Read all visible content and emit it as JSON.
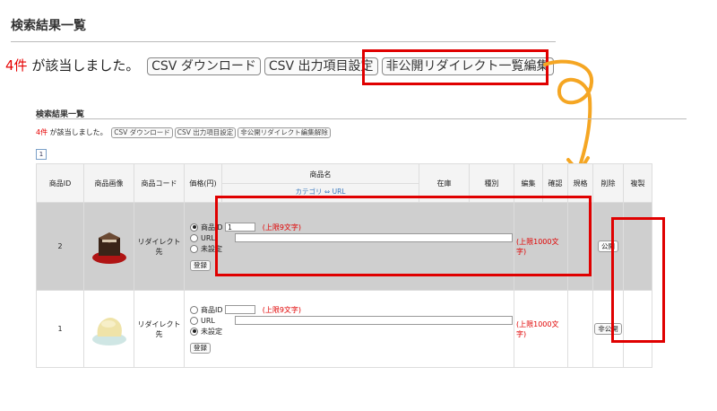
{
  "big": {
    "title": "検索結果一覧",
    "count": "4件",
    "summary": "が該当しました。",
    "btn_csv_download": "CSV ダウンロード",
    "btn_csv_settings": "CSV 出力項目設定",
    "btn_redirect_edit": "非公開リダイレクト一覧編集"
  },
  "small": {
    "title": "検索結果一覧",
    "count": "4件",
    "summary": "が該当しました。",
    "btn_csv_download": "CSV ダウンロード",
    "btn_csv_settings": "CSV 出力項目設定",
    "btn_redirect_cancel": "非公開リダイレクト編集解除",
    "page": "1"
  },
  "table": {
    "headers": {
      "id": "商品ID",
      "image": "商品画像",
      "code": "商品コード",
      "price": "価格(円)",
      "name": "商品名",
      "name_sub": "カテゴリ ⇔ URL",
      "stock": "在庫",
      "type": "種別",
      "edit": "編集",
      "confirm": "確認",
      "spec": "規格",
      "delete": "削除",
      "copy": "複製"
    },
    "rows": [
      {
        "id": "2",
        "code": "リダイレクト先",
        "opt_id": "商品ID",
        "id_value": "1",
        "id_limit": "(上限9文字)",
        "opt_url": "URL",
        "url_value": "",
        "url_limit": "(上限1000文字)",
        "opt_none": "未設定",
        "register": "登録",
        "status_btn": "公開"
      },
      {
        "id": "1",
        "code": "リダイレクト先",
        "opt_id": "商品ID",
        "id_value": "",
        "id_limit": "(上限9文字)",
        "opt_url": "URL",
        "url_value": "",
        "url_limit": "(上限1000文字)",
        "opt_none": "未設定",
        "register": "登録",
        "status_btn": "非公開"
      }
    ]
  },
  "colors": {
    "highlight": "#e00000",
    "arrow": "#f5a623",
    "selected_row": "#cfcfcf",
    "count": "#e60000"
  }
}
